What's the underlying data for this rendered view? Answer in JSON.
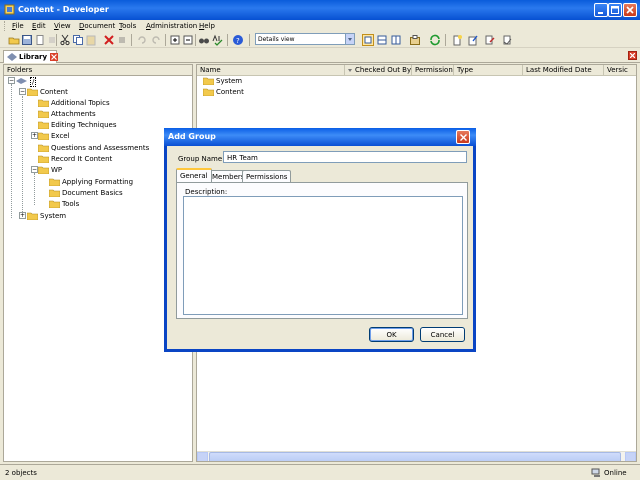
{
  "window": {
    "title": "Content - Developer",
    "icon": "app-icon"
  },
  "menu": [
    {
      "label": "File",
      "mnemonic": "F",
      "rest": "ile"
    },
    {
      "label": "Edit",
      "mnemonic": "E",
      "rest": "dit"
    },
    {
      "label": "View",
      "mnemonic": "V",
      "rest": "iew"
    },
    {
      "label": "Document",
      "mnemonic": "D",
      "rest": "ocument"
    },
    {
      "label": "Tools",
      "mnemonic": "T",
      "rest": "ools"
    },
    {
      "label": "Administration",
      "mnemonic": "A",
      "rest": "dministration"
    },
    {
      "label": "Help",
      "mnemonic": "H",
      "rest": "elp"
    }
  ],
  "toolbar": {
    "view_select": "Details view"
  },
  "tabs": {
    "library": "Library"
  },
  "folders": {
    "header": "Folders",
    "root": "/",
    "items": [
      {
        "label": "Content"
      },
      {
        "label": "Additional Topics"
      },
      {
        "label": "Attachments"
      },
      {
        "label": "Editing Techniques"
      },
      {
        "label": "Excel"
      },
      {
        "label": "Questions and Assessments"
      },
      {
        "label": "Record It Content"
      },
      {
        "label": "WP"
      },
      {
        "label": "Applying Formatting"
      },
      {
        "label": "Document Basics"
      },
      {
        "label": "Tools"
      },
      {
        "label": "System"
      }
    ]
  },
  "details": {
    "columns": [
      "Name",
      "Checked Out By",
      "Permission",
      "Type",
      "Last Modified Date",
      "Versic"
    ],
    "rows": [
      {
        "name": "System"
      },
      {
        "name": "Content"
      }
    ]
  },
  "status": {
    "count": "2 objects",
    "connection": "Online"
  },
  "dialog": {
    "title": "Add Group",
    "group_name_label": "Group Name:",
    "group_name_value": "HR Team",
    "tabs": [
      "General",
      "Members",
      "Permissions"
    ],
    "description_label": "Description:",
    "ok": "OK",
    "cancel": "Cancel"
  },
  "colors": {
    "titlebar": "#0a5cdb",
    "folder": "#f2c94c",
    "active_tab_accent": "#ffc73c"
  }
}
